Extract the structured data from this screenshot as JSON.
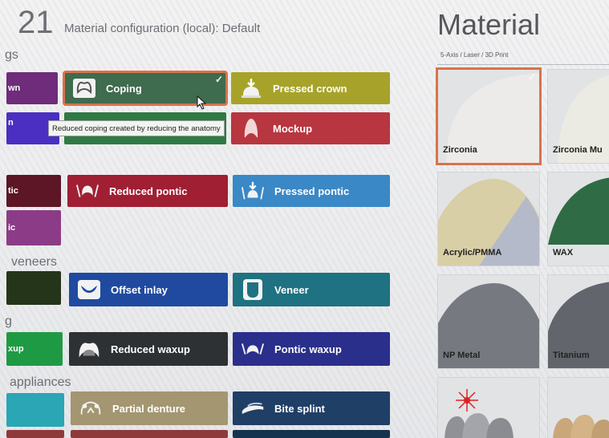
{
  "header": {
    "tooth_number": "21",
    "config_label": "Material configuration (local):",
    "config_value": "Default"
  },
  "material_panel": {
    "title": "Material",
    "subtitle": "5-Axis / Laser / 3D Print",
    "cards": [
      {
        "label": "Zirconia",
        "selected": true
      },
      {
        "label": "Zirconia Mu"
      },
      {
        "label": "Acrylic/PMMA"
      },
      {
        "label": "WAX"
      },
      {
        "label": "NP Metal"
      },
      {
        "label": "Titanium"
      }
    ]
  },
  "sections": {
    "crowns_partial": "gs",
    "veneers": "veneers",
    "waxup_partial": "g",
    "appliances": "appliances"
  },
  "tiles": {
    "coping": "Coping",
    "pressed_crown": "Pressed crown",
    "mockup": "Mockup",
    "reduced_pontic": "Reduced pontic",
    "pressed_pontic": "Pressed pontic",
    "offset_inlay": "Offset inlay",
    "veneer": "Veneer",
    "reduced_waxup": "Reduced waxup",
    "pontic_waxup": "Pontic waxup",
    "partial_denture": "Partial denture",
    "bite_splint": "Bite splint"
  },
  "stubs": {
    "crown": "wn",
    "stub2": "n",
    "pontic": "tic",
    "pontic2": "ic",
    "waxup": "xup"
  },
  "tooltip": "Reduced coping created by reducing the anatomy",
  "colors": {
    "coping": "#3f6b4e",
    "pressed_crown": "#a7a32a",
    "mockup": "#b8363f",
    "reduced_pontic": "#a01f33",
    "pressed_pontic": "#3a88c6",
    "offset_inlay": "#1f4aa0",
    "veneer": "#1e7281",
    "reduced_waxup": "#2e3133",
    "pontic_waxup": "#2a2f8c",
    "partial_denture": "#a39670",
    "bite_splint": "#1f3f66",
    "selected_outline": "#d9734a"
  }
}
